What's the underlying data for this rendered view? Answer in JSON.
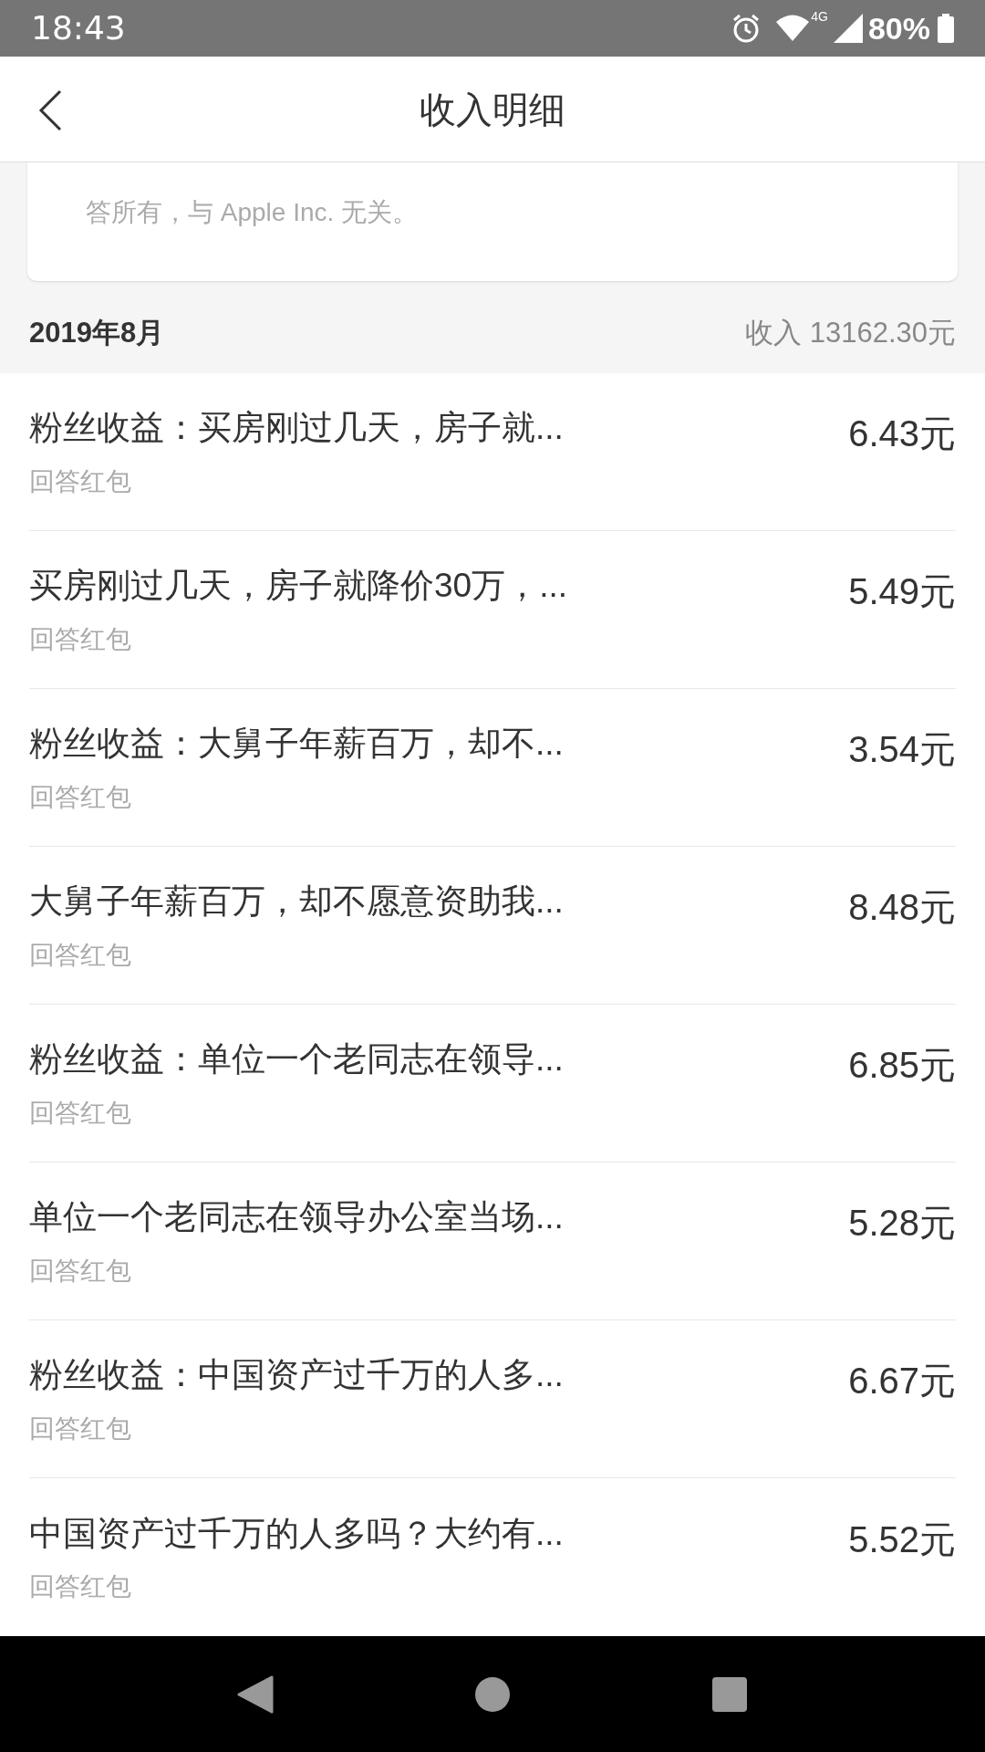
{
  "status_bar": {
    "time": "18:43",
    "network": "4G",
    "battery": "80%"
  },
  "header": {
    "title": "收入明细"
  },
  "notice": {
    "text": "答所有，与 Apple Inc. 无关。"
  },
  "month": {
    "label": "2019年8月",
    "total": "收入 13162.30元"
  },
  "rows": [
    {
      "title": "粉丝收益：买房刚过几天，房子就...",
      "subtitle": "回答红包",
      "amount": "6.43元"
    },
    {
      "title": "买房刚过几天，房子就降价30万，...",
      "subtitle": "回答红包",
      "amount": "5.49元"
    },
    {
      "title": "粉丝收益：大舅子年薪百万，却不...",
      "subtitle": "回答红包",
      "amount": "3.54元"
    },
    {
      "title": "大舅子年薪百万，却不愿意资助我...",
      "subtitle": "回答红包",
      "amount": "8.48元"
    },
    {
      "title": "粉丝收益：单位一个老同志在领导...",
      "subtitle": "回答红包",
      "amount": "6.85元"
    },
    {
      "title": "单位一个老同志在领导办公室当场...",
      "subtitle": "回答红包",
      "amount": "5.28元"
    },
    {
      "title": "粉丝收益：中国资产过千万的人多...",
      "subtitle": "回答红包",
      "amount": "6.67元"
    },
    {
      "title": "中国资产过千万的人多吗？大约有...",
      "subtitle": "回答红包",
      "amount": "5.52元"
    }
  ]
}
